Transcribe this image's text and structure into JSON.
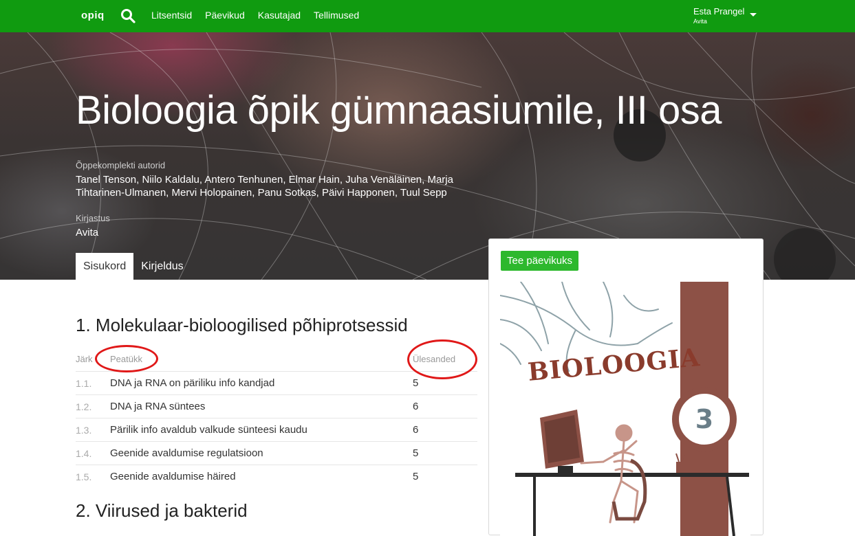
{
  "nav": {
    "logo": "opiq",
    "links": [
      "Litsentsid",
      "Päevikud",
      "Kasutajad",
      "Tellimused"
    ],
    "user_name": "Esta Prangel",
    "user_org": "Avita"
  },
  "hero": {
    "title": "Bioloogia õpik gümnaasiumile, III osa",
    "authors_label": "Õppekomplekti autorid",
    "authors": "Tanel Tenson, Niilo Kaldalu, Antero Tenhunen, Elmar Hain, Juha Venäläinen, Marja Tihtarinen-Ulmanen, Mervi Holopainen, Panu Sotkas, Päivi Happonen, Tuul Sepp",
    "publisher_label": "Kirjastus",
    "publisher": "Avita",
    "tabs": [
      "Sisukord",
      "Kirjeldus"
    ]
  },
  "content": {
    "section1_title": "1. Molekulaar-bioloogilised põhiprotsessid",
    "col_order": "Järk",
    "col_chapter": "Peatükk",
    "col_tasks": "Ülesanded",
    "rows": [
      {
        "num": "1.1.",
        "title": "DNA ja RNA on päriliku info kandjad",
        "tasks": "5"
      },
      {
        "num": "1.2.",
        "title": "DNA ja RNA süntees",
        "tasks": "6"
      },
      {
        "num": "1.3.",
        "title": "Pärilik info avaldub valkude sünteesi kaudu",
        "tasks": "6"
      },
      {
        "num": "1.4.",
        "title": "Geenide avaldumise regulatsioon",
        "tasks": "5"
      },
      {
        "num": "1.5.",
        "title": "Geenide avaldumise häired",
        "tasks": "5"
      }
    ],
    "section2_title": "2. Viirused ja bakterid"
  },
  "card": {
    "button_label": "Tee päevikuks",
    "cover_title": "BIOLOOGIA",
    "cover_number": "3"
  },
  "colors": {
    "navbar": "#109b10",
    "button": "#2db82d",
    "annotation": "#e01818"
  },
  "icons": [
    "search-icon",
    "chevron-down-icon"
  ]
}
